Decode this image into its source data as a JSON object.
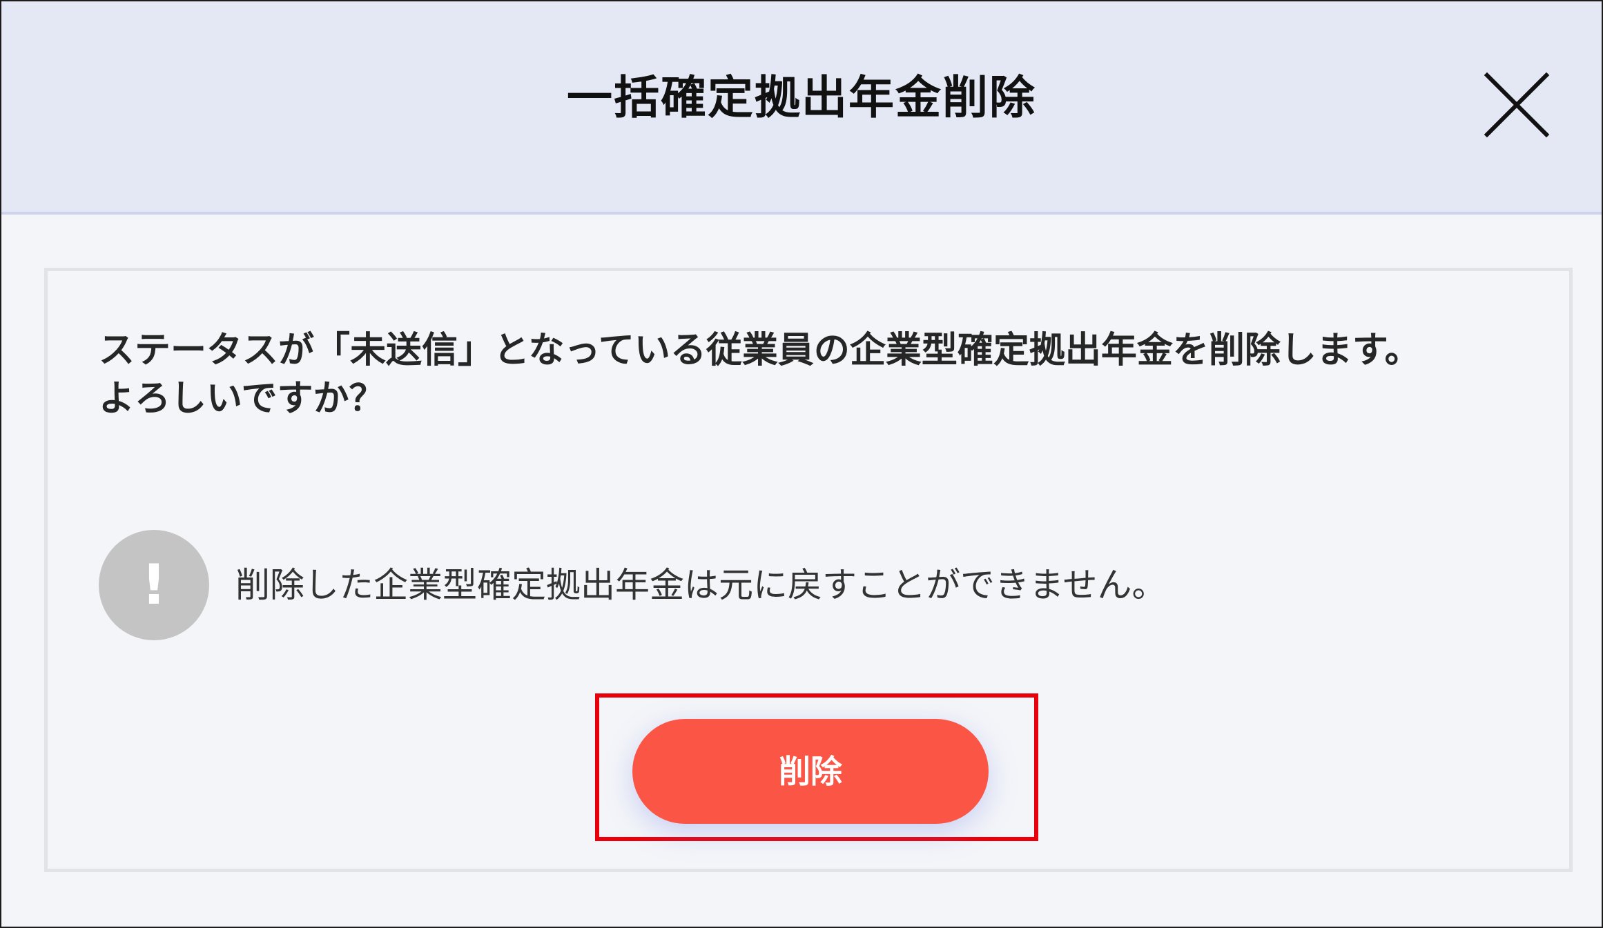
{
  "dialog": {
    "title": "一括確定拠出年金削除",
    "close_icon": "close-icon",
    "message_lines": [
      "ステータスが「未送信」となっている従業員の企業型確定拠出年金を削除します。",
      "よろしいですか？"
    ],
    "warning": {
      "icon": "exclamation-icon",
      "icon_glyph": "!",
      "text": "削除した企業型確定拠出年金は元に戻すことができません。"
    },
    "delete_button_label": "削除"
  },
  "colors": {
    "header_bg": "#e4e8f5",
    "body_bg": "#f4f5f9",
    "delete_button": "#fb5546",
    "highlight_frame": "#e8000c",
    "warning_icon_bg": "#c4c4c4"
  }
}
